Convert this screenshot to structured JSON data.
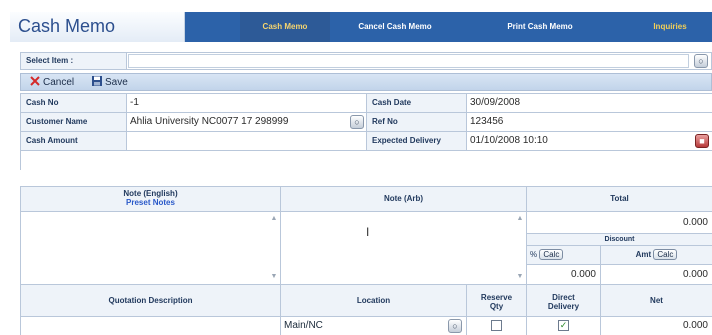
{
  "app": {
    "title": "Cash Memo"
  },
  "nav": {
    "tabs": [
      {
        "label": "Cash Memo",
        "active": true
      },
      {
        "label": "Cancel Cash Memo",
        "active": false
      },
      {
        "label": "Print Cash Memo",
        "active": false
      },
      {
        "label": "Inquiries",
        "active": false
      }
    ]
  },
  "select_item": {
    "label": "Select Item :",
    "value": ""
  },
  "toolbar": {
    "cancel_label": "Cancel",
    "save_label": "Save"
  },
  "info": {
    "cash_no_label": "Cash No",
    "cash_no_value": "-1",
    "cash_date_label": "Cash Date",
    "cash_date_value": "30/09/2008",
    "customer_name_label": "Customer Name",
    "customer_name_value": "Ahlia University NC0077 17 298999",
    "ref_no_label": "Ref No",
    "ref_no_value": "123456",
    "cash_amount_label": "Cash Amount",
    "cash_amount_value": "",
    "expected_delivery_label": "Expected Delivery",
    "expected_delivery_value": "01/10/2008 10:10"
  },
  "notes": {
    "note_english_label": "Note (English)",
    "preset_notes_link": "Preset Notes",
    "note_arabic_label": "Note (Arb)",
    "note_english_value": "",
    "note_arabic_value": "",
    "total_label": "Total",
    "total_value": "0.000",
    "discount_label": "Discount",
    "percent_label": "%",
    "amount_label": "Amt",
    "calc_label": "Calc",
    "discount_percent_value": "0.000",
    "discount_amount_value": "0.000"
  },
  "quotation": {
    "description_label": "Quotation Description",
    "location_label": "Location",
    "reserve_qty_label_1": "Reserve",
    "reserve_qty_label_2": "Qty",
    "direct_delivery_label_1": "Direct",
    "direct_delivery_label_2": "Delivery",
    "net_label": "Net",
    "description_value": "",
    "location_value": "Main/NC",
    "reserve_qty_checked": false,
    "direct_delivery_checked": true,
    "net_value": "0.000"
  },
  "colors": {
    "nav_bg": "#2c62a9",
    "active_tab_text": "#f6d56f",
    "label_bg": "#eef3f9",
    "link": "#2a59c9"
  }
}
